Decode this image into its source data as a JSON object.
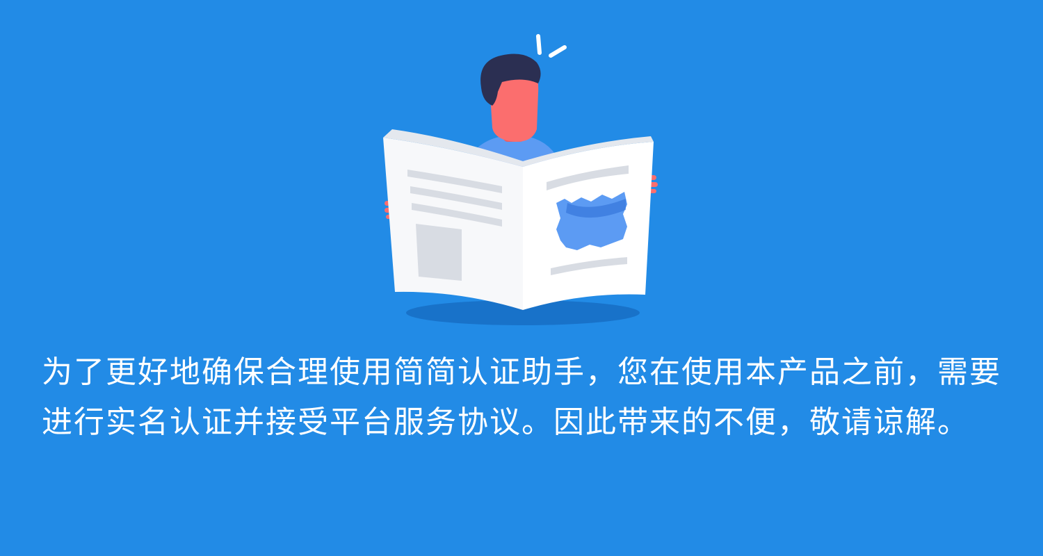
{
  "colors": {
    "background": "#228BE6",
    "text": "#FFFFFF",
    "shadow": "#1872C9",
    "hair": "#2B2F52",
    "skin": "#FB6E6E",
    "shirt": "#5C9BF3",
    "paper": "#F7F8FA",
    "paper_shade": "#E4E8EE",
    "paper_lines": "#D8DCE3"
  },
  "illustration": {
    "icon": "person-reading-newspaper-icon"
  },
  "notice": {
    "text": "为了更好地确保合理使用简简认证助手，您在使用本产品之前，需要进行实名认证并接受平台服务协议。因此带来的不便，敬请谅解。"
  }
}
